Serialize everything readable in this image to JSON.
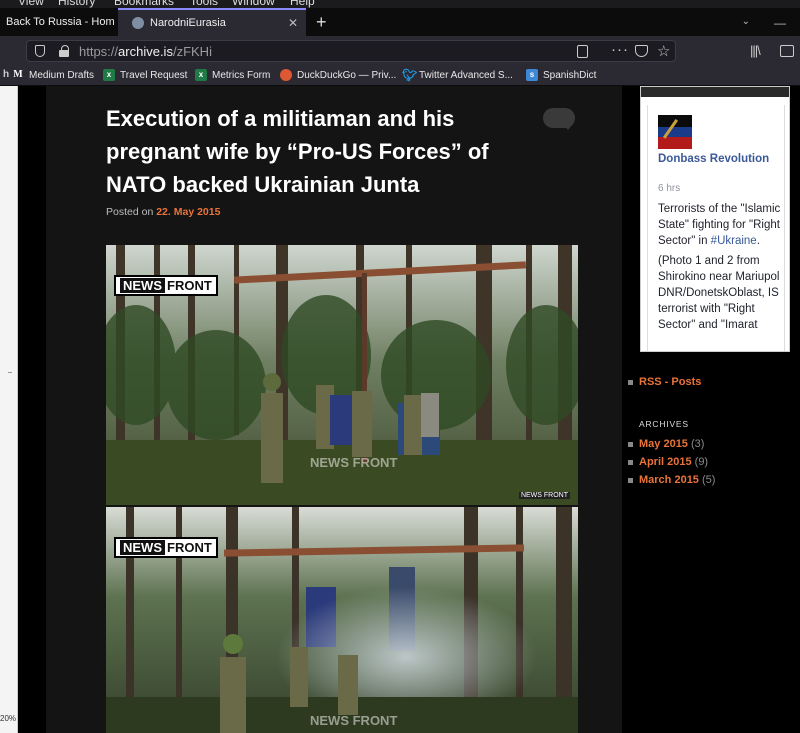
{
  "browser": {
    "menu_items": [
      "View",
      "History",
      "Bookmarks",
      "Tools",
      "Window",
      "Help"
    ],
    "tabs": [
      {
        "label": "Back To Russia - Hom",
        "active": false
      },
      {
        "label": "NarodniEurasia",
        "active": true
      }
    ],
    "url_prefix": "https://",
    "url_main": "archive.is",
    "url_path": "/zFKHi",
    "bookmarks": [
      {
        "label": "Medium Drafts",
        "icon": "M"
      },
      {
        "label": "Travel Request",
        "icon": "excel-icon"
      },
      {
        "label": "Metrics Form",
        "icon": "excel-icon"
      },
      {
        "label": "DuckDuckGo — Priv...",
        "icon": "duckduckgo-icon"
      },
      {
        "label": "Twitter Advanced S...",
        "icon": "twitter-icon"
      },
      {
        "label": "SpanishDict",
        "icon": "spanishdict-icon"
      }
    ],
    "zoom": "20%"
  },
  "post": {
    "title": "Execution of a militiaman and his pregnant wife by “Pro-US Forces” of NATO backed Ukrainian Junta",
    "posted_on": "Posted on",
    "date": "22. May 2015",
    "photo_logo_news": "NEWS",
    "photo_logo_front": "FRONT",
    "watermark": "NEWS FRONT"
  },
  "sidebar": {
    "fb_page_name": "Donbass Revolution",
    "fb_time": "6 hrs",
    "fb_text_1a": "Terrorists of the \"Islamic State\" fighting for \"Right Sector\" in ",
    "fb_hashtag": "#Ukraine",
    "fb_text_1b": ".",
    "fb_text_2": "(Photo 1 and 2 from Shirokino near Mariupol DNR/DonetskOblast, IS terrorist with \"Right Sector\" and \"Imarat",
    "rss_label": "RSS - Posts",
    "archives_title": "ARCHIVES",
    "archives": [
      {
        "month": "May 2015",
        "count": "(3)"
      },
      {
        "month": "April 2015",
        "count": "(9)"
      },
      {
        "month": "March 2015",
        "count": "(5)"
      }
    ]
  },
  "colors": {
    "accent": "#e8733a",
    "page_bg": "#000000",
    "content_bg": "#141414",
    "fb_link": "#3b5998"
  }
}
